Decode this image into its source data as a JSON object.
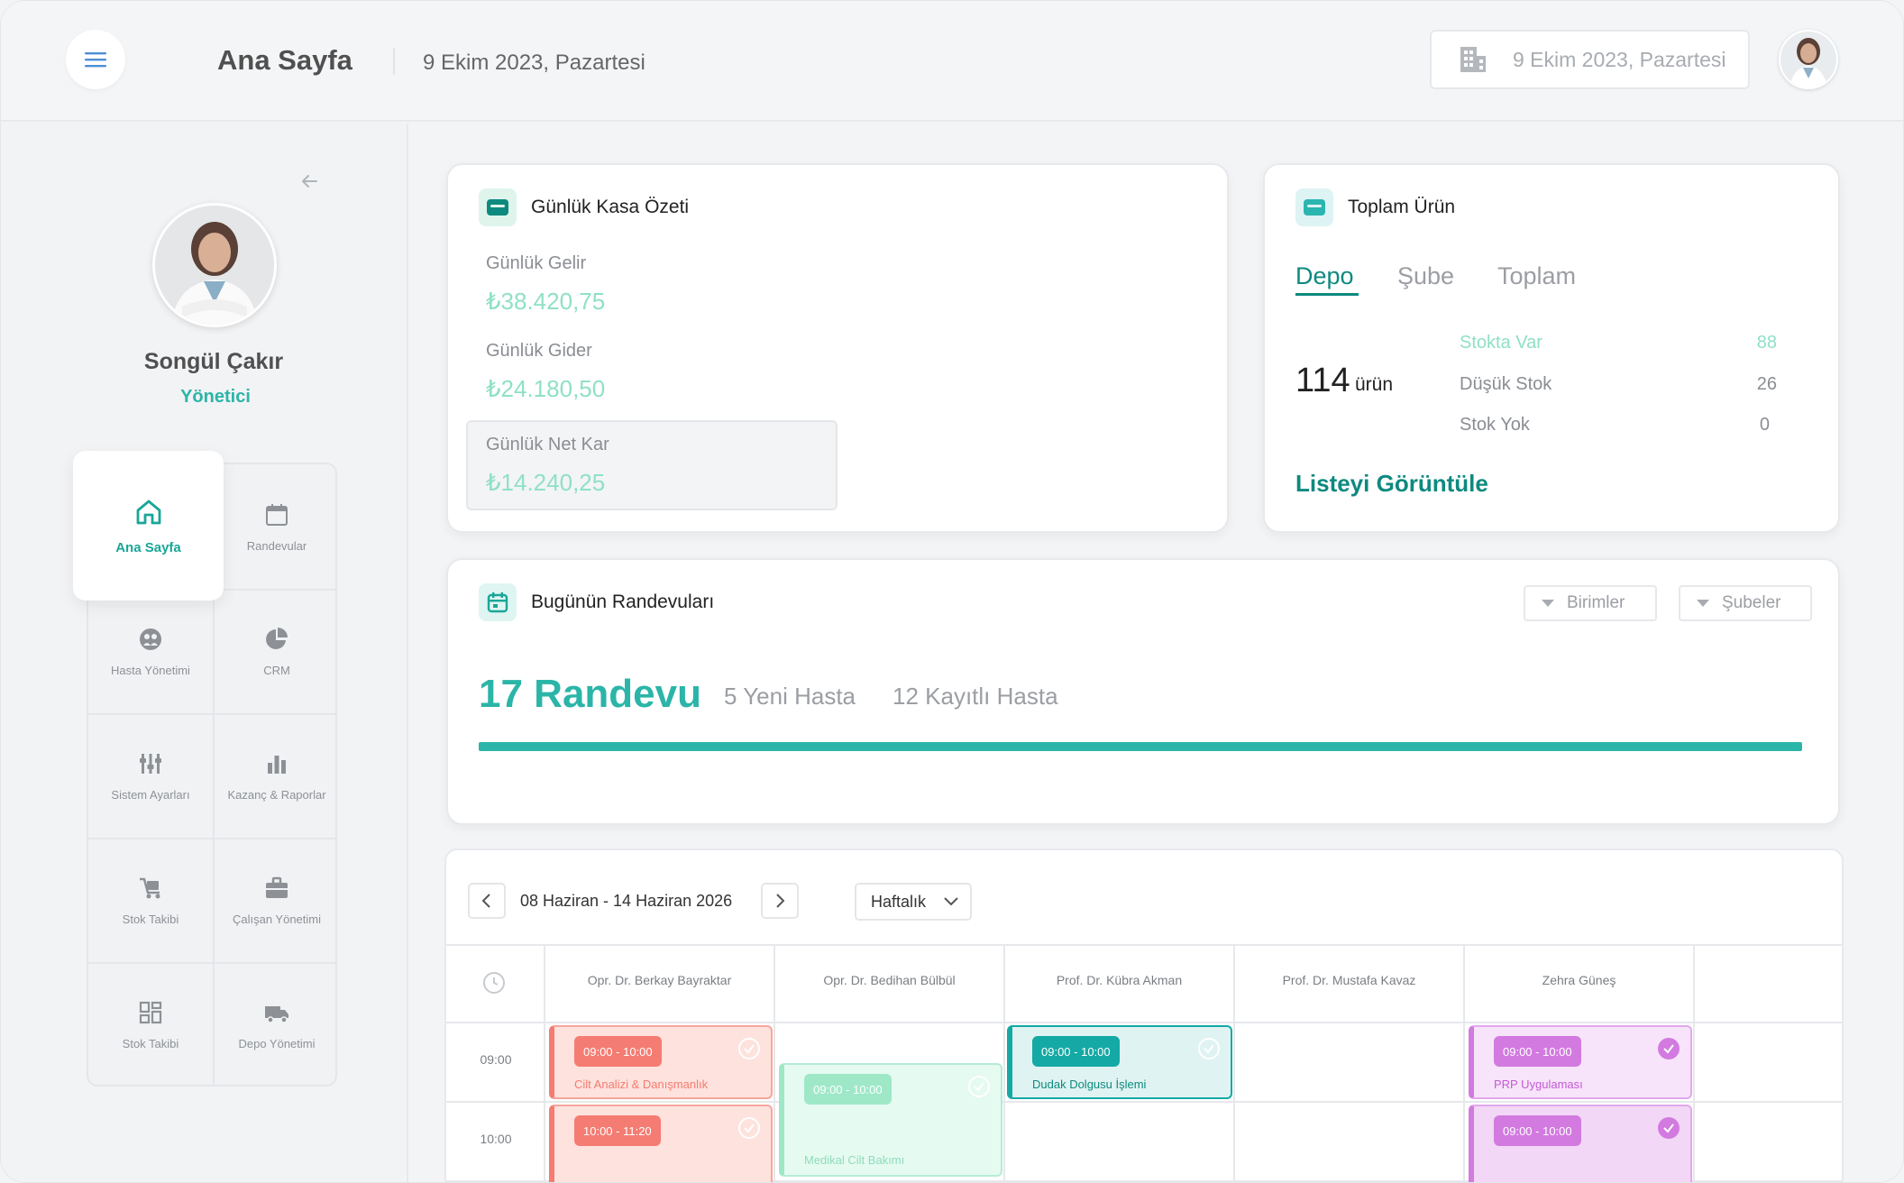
{
  "header": {
    "title": "Ana Sayfa",
    "date": "9 Ekim 2023, Pazartesi",
    "date_box": "9 Ekim 2023, Pazartesi"
  },
  "profile": {
    "name": "Songül Çakır",
    "role": "Yönetici"
  },
  "nav": {
    "active": "Ana Sayfa",
    "items": [
      "Randevular",
      "Hasta Yönetimi",
      "CRM",
      "Sistem Ayarları",
      "Kazanç & Raporlar",
      "Stok Takibi",
      "Çalışan Yönetimi",
      "Stok Takibi",
      "Depo Yönetimi"
    ]
  },
  "kasa": {
    "title": "Günlük Kasa Özeti",
    "income_label": "Günlük Gelir",
    "income_value": "₺38.420,75",
    "expense_label": "Günlük Gider",
    "expense_value": "₺24.180,50",
    "net_label": "Günlük Net Kar",
    "net_value": "₺14.240,25"
  },
  "urun": {
    "title": "Toplam Ürün",
    "tabs": [
      "Depo",
      "Şube",
      "Toplam"
    ],
    "total": "114",
    "unit": "ürün",
    "stock": [
      {
        "label": "Stokta Var",
        "value": "88"
      },
      {
        "label": "Düşük Stok",
        "value": "26"
      },
      {
        "label": "Stok Yok",
        "value": "0"
      }
    ],
    "link": "Listeyi Görüntüle"
  },
  "randevu": {
    "title": "Bugünün Randevuları",
    "filter_units": "Birimler",
    "filter_branches": "Şubeler",
    "total": "17 Randevu",
    "new_patients": "5 Yeni Hasta",
    "registered_patients": "12 Kayıtlı Hasta",
    "progress": 1.0
  },
  "calendar": {
    "range": "08 Haziran - 14 Haziran 2026",
    "view": "Haftalık",
    "doctors": [
      "Opr. Dr. Berkay Bayraktar",
      "Opr. Dr. Bedihan Bülbül",
      "Prof. Dr. Kübra Akman",
      "Prof. Dr. Mustafa Kavaz",
      "Zehra Güneş"
    ],
    "times": [
      "09:00",
      "10:00"
    ],
    "appointments": [
      {
        "time": "09:00 - 10:00",
        "desc": "Cilt Analizi & Danışmanlık"
      },
      {
        "time": "10:00 - 11:20",
        "desc": ""
      },
      {
        "time": "09:00 - 10:00",
        "desc": "Medikal Cilt Bakımı"
      },
      {
        "time": "09:00 - 10:00",
        "desc": "Dudak Dolgusu İşlemi"
      },
      {
        "time": "09:00 - 10:00",
        "desc": "PRP Uygulaması"
      },
      {
        "time": "09:00 - 10:00",
        "desc": ""
      }
    ]
  },
  "colors": {
    "accent": "#2bb5a8",
    "accent_dark": "#0d8a7f",
    "money": "#8fe0c7",
    "appt_red": "#f47c72",
    "appt_green": "#9ee8c8",
    "appt_teal": "#14a9a4",
    "appt_purple": "#d27ae0"
  }
}
